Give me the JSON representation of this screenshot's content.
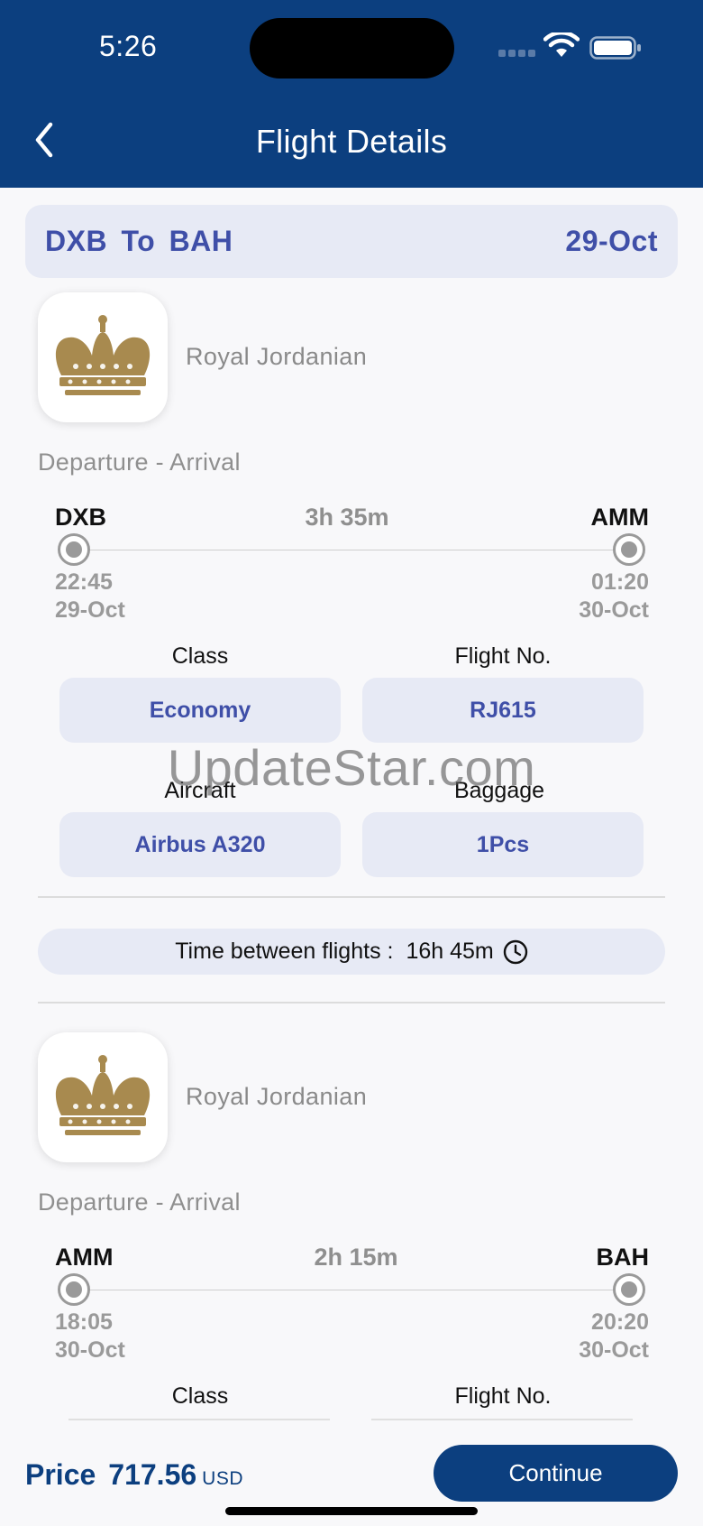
{
  "status_bar": {
    "time": "5:26"
  },
  "header": {
    "title": "Flight Details",
    "back_icon": "chevron-left-icon"
  },
  "route": {
    "text": "DXB To BAH",
    "date": "29-Oct"
  },
  "segments": [
    {
      "airline": "Royal Jordanian",
      "logo_icon": "crown-logo-icon",
      "section_label": "Departure - Arrival",
      "from": "DXB",
      "to": "AMM",
      "duration": "3h 35m",
      "dep_time": "22:45",
      "dep_date": "29-Oct",
      "arr_time": "01:20",
      "arr_date": "30-Oct",
      "class_label": "Class",
      "class_value": "Economy",
      "flight_label": "Flight No.",
      "flight_value": "RJ615",
      "aircraft_label": "Aircraft",
      "aircraft_value": "Airbus A320",
      "baggage_label": "Baggage",
      "baggage_value": "1Pcs"
    },
    {
      "airline": "Royal Jordanian",
      "logo_icon": "crown-logo-icon",
      "section_label": "Departure - Arrival",
      "from": "AMM",
      "to": "BAH",
      "duration": "2h 15m",
      "dep_time": "18:05",
      "dep_date": "30-Oct",
      "arr_time": "20:20",
      "arr_date": "30-Oct",
      "class_label": "Class",
      "flight_label": "Flight No."
    }
  ],
  "layover": {
    "label": "Time between flights :",
    "value": "16h 45m",
    "icon": "clock-icon"
  },
  "watermark": "UpdateStar.com",
  "footer": {
    "price_label": "Price",
    "price_amount": "717.56",
    "currency": "USD",
    "continue_label": "Continue"
  },
  "colors": {
    "header_bg": "#0c3f7f",
    "accent": "#3f4fa8",
    "pill_bg": "#e7eaf5"
  }
}
